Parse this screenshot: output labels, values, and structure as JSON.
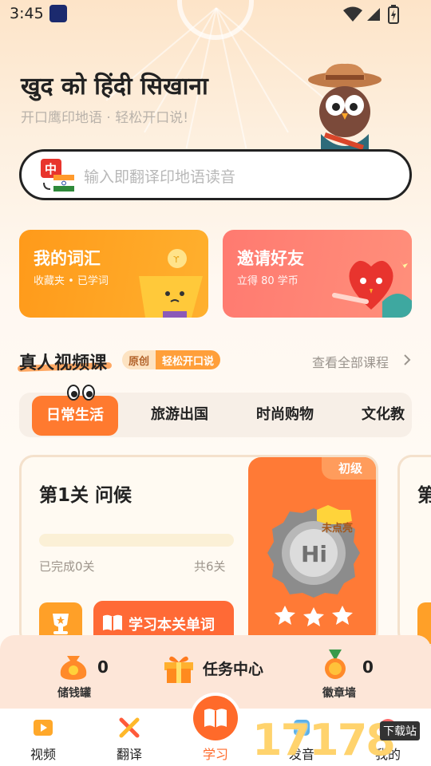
{
  "status_bar": {
    "time": "3:45"
  },
  "hero": {
    "title": "खुद को हिंदी सिखाना",
    "subtitle": "开口鹰印地语 · 轻松开口说!"
  },
  "search": {
    "placeholder": "输入即翻译印地语读音",
    "flag_label": "中"
  },
  "cards": {
    "vocab": {
      "title": "我的词汇",
      "subtitle": "收藏夹 • 已学词"
    },
    "invite": {
      "title": "邀请好友",
      "subtitle": "立得 80 学币"
    }
  },
  "section": {
    "title": "真人视频课",
    "badge_original": "原创",
    "badge_easy": "轻松开口说",
    "view_all": "查看全部课程"
  },
  "tabs": [
    {
      "label": "日常生活"
    },
    {
      "label": "旅游出国"
    },
    {
      "label": "时尚购物"
    },
    {
      "label": "文化教"
    }
  ],
  "lesson": {
    "title": "第1关 问候",
    "completed": "已完成0关",
    "total": "共6关",
    "study_button": "学习本关单词",
    "level": "初级",
    "unlit": "未点亮",
    "next_title": "第"
  },
  "stats": {
    "piggy": {
      "label": "储钱罐",
      "count": "0"
    },
    "task_center": "任务中心",
    "badges": {
      "label": "徽章墙",
      "count": "0"
    }
  },
  "nav": [
    {
      "label": "视频"
    },
    {
      "label": "翻译"
    },
    {
      "label": "学习"
    },
    {
      "label": "发音"
    },
    {
      "label": "我的"
    }
  ],
  "watermark": {
    "text": "17178",
    "tag": "下载站"
  },
  "colors": {
    "accent": "#ff6a2a",
    "vocab_card": "#ff9a1a",
    "invite_card": "#ff7a70"
  }
}
